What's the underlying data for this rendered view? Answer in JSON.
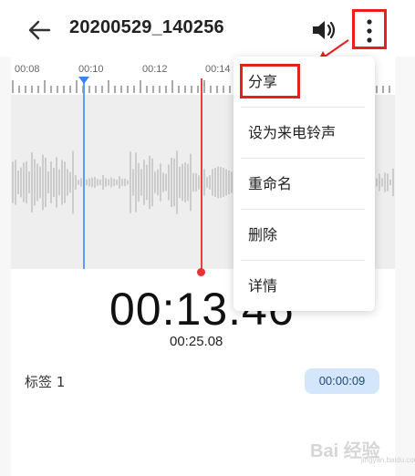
{
  "header": {
    "title": "20200529_140256",
    "back_icon": "arrow-left-icon",
    "volume_icon": "speaker-icon",
    "more_icon": "more-vertical-icon"
  },
  "ruler": {
    "ticks": [
      "00:08",
      "00:10",
      "00:12",
      "00:14"
    ]
  },
  "playback": {
    "current_time": "00:13.46",
    "total_time": "00:25.08"
  },
  "tag": {
    "label": "标签 1",
    "time": "00:00:09"
  },
  "menu": {
    "items": [
      {
        "label": "分享"
      },
      {
        "label": "设为来电铃声"
      },
      {
        "label": "重命名"
      },
      {
        "label": "删除"
      },
      {
        "label": "详情"
      }
    ]
  },
  "colors": {
    "annotation": "#e8201c",
    "playhead": "#ef3c3c",
    "marker": "#5a9ef5",
    "tag_bg": "#d3e6fb"
  },
  "watermark": {
    "text": "Bai 经验",
    "sub": "jingyan.baidu.com"
  }
}
